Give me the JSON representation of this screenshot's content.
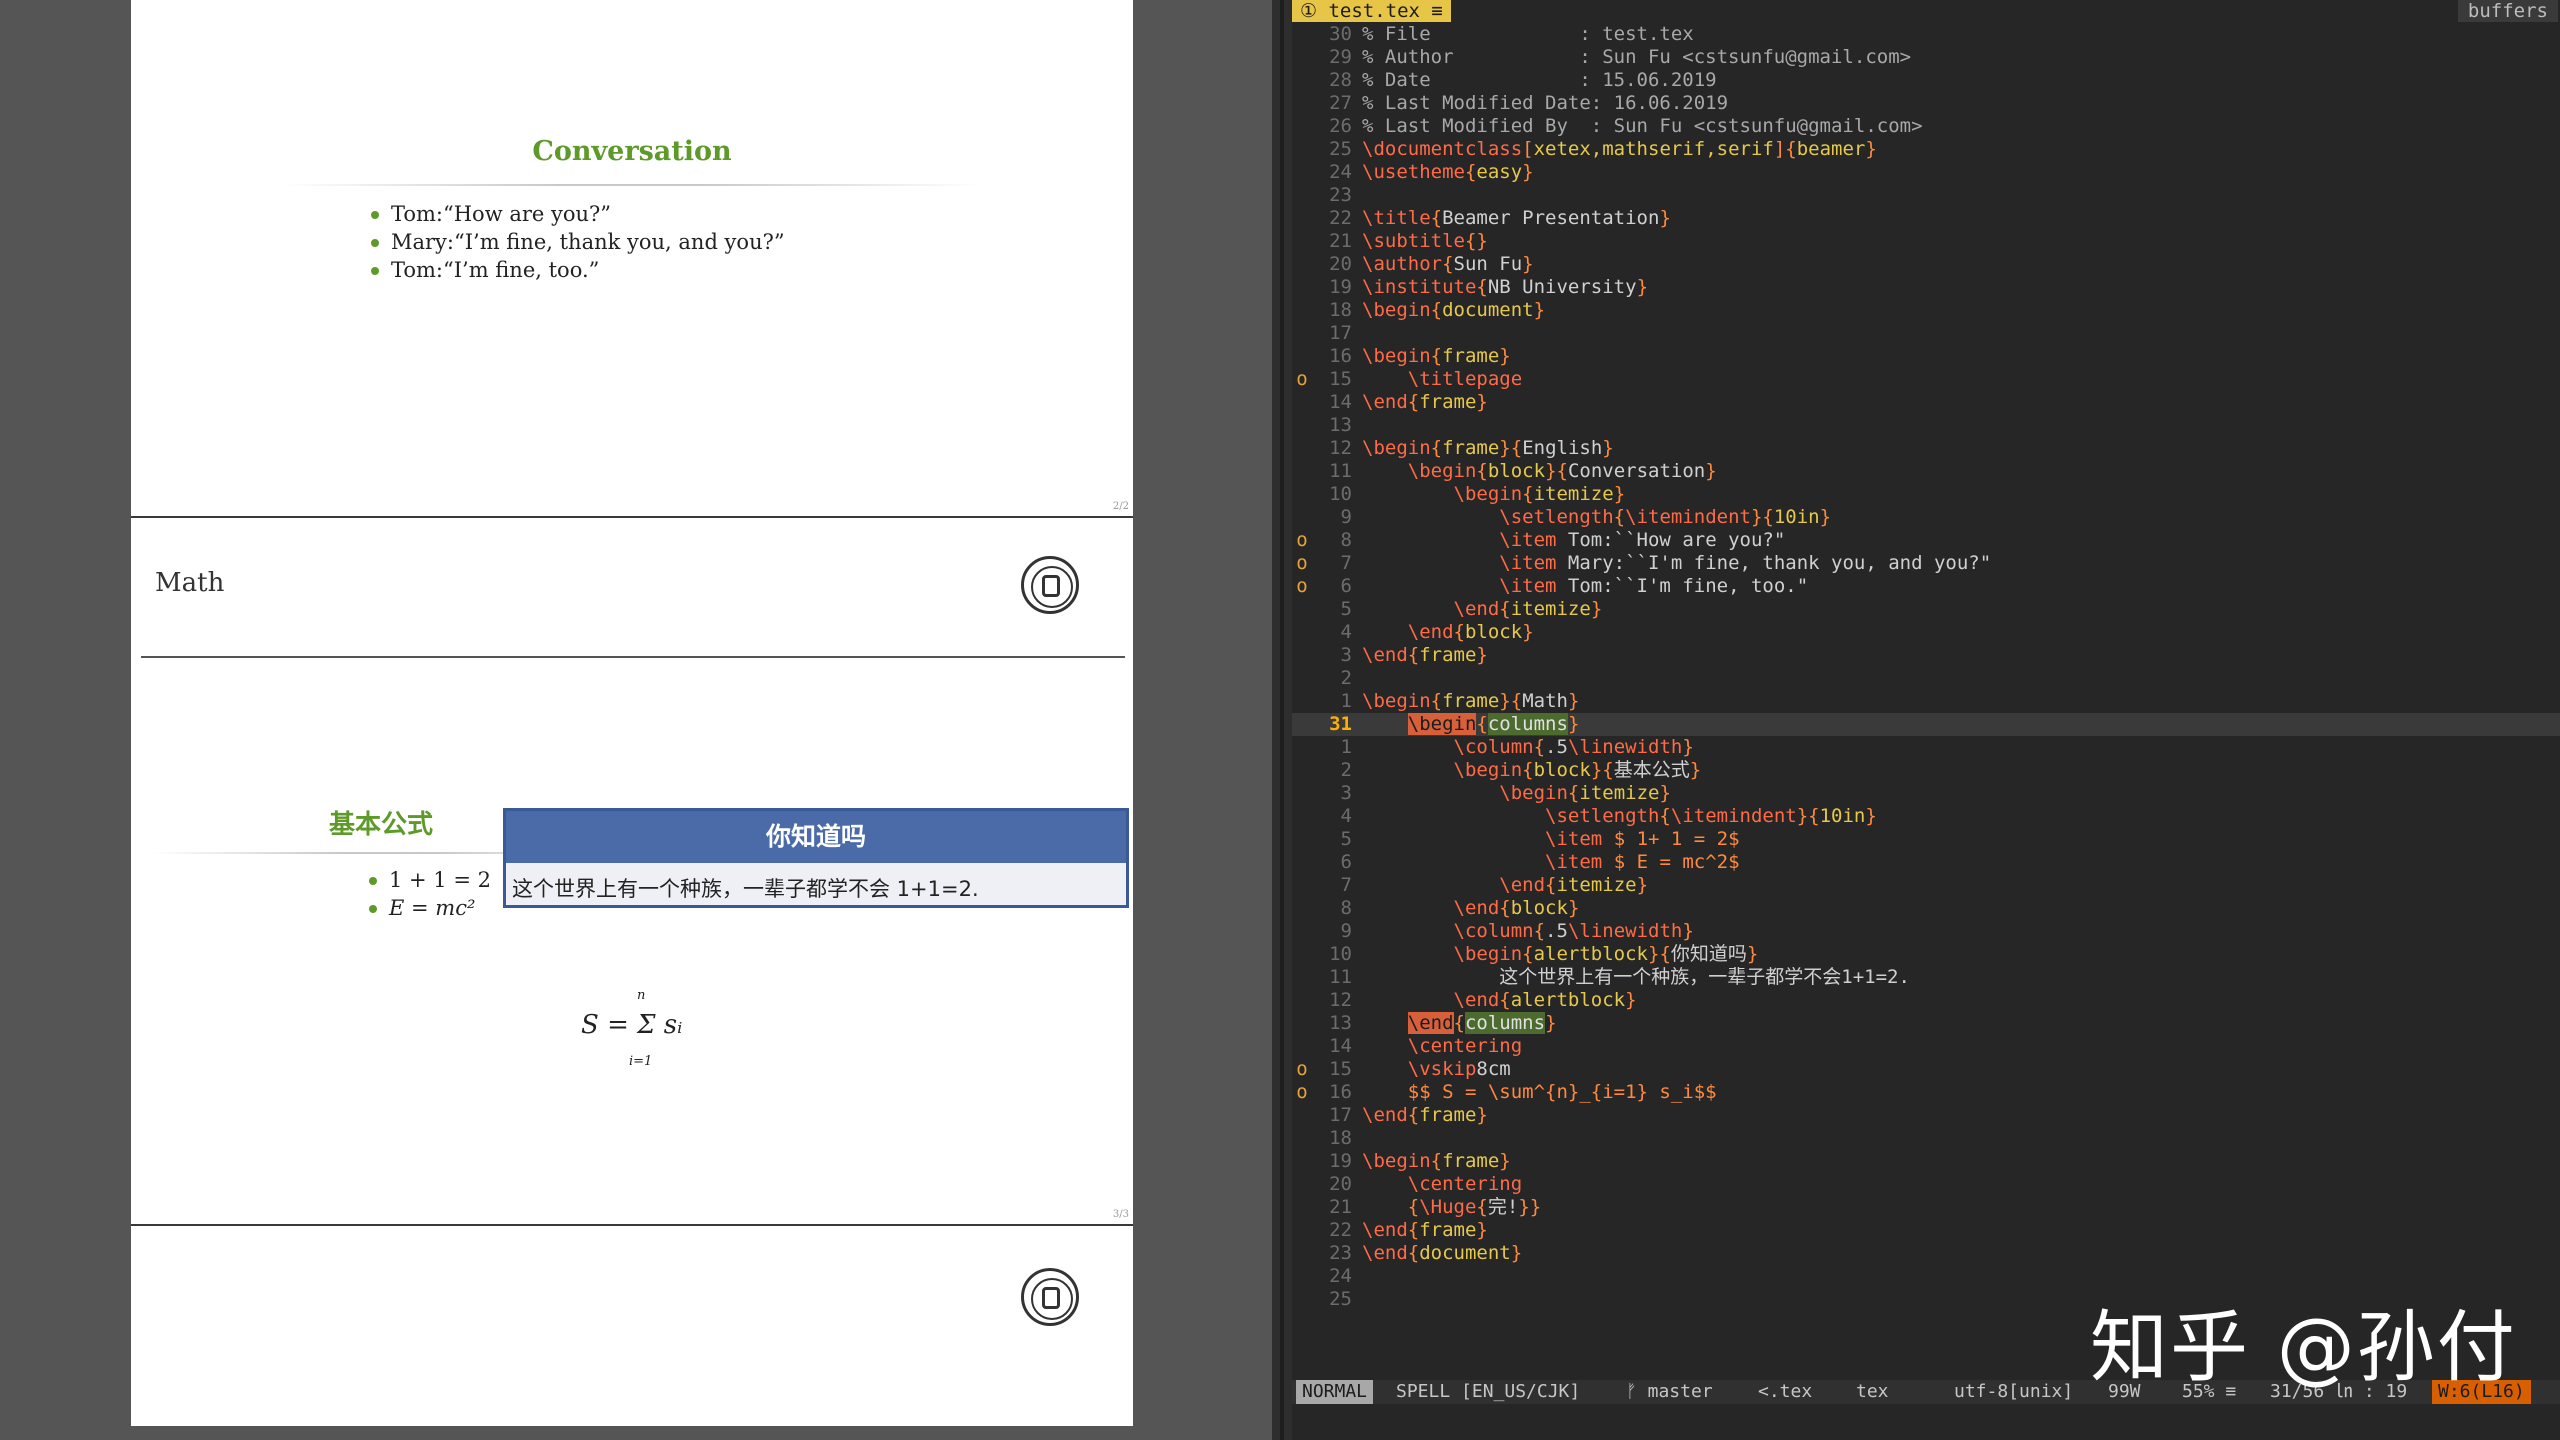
{
  "pdf": {
    "page1": {
      "block_title": "Conversation",
      "items": [
        "Tom:“How are you?”",
        "Mary:“I’m fine, thank you, and you?”",
        "Tom:“I’m fine, too.”"
      ],
      "page_number": "2/2"
    },
    "page2": {
      "frame_title": "Math",
      "block_title": "基本公式",
      "items": [
        "1 + 1 = 2",
        "E = mc²"
      ],
      "alert_title": "你知道吗",
      "alert_body": "这个世界上有一个种族，一辈子都学不会 1+1=2.",
      "formula": "S = Σ sᵢ",
      "formula_upper": "n",
      "formula_lower": "i=1",
      "page_number": "3/3"
    }
  },
  "vim": {
    "tab_active": "① test.tex ≡",
    "tab_right": "buffers",
    "lines": [
      {
        "n": "30",
        "sign": "",
        "cur": false,
        "html": "<span class='c-cm'>% File             : test.tex</span>"
      },
      {
        "n": "29",
        "sign": "",
        "cur": false,
        "html": "<span class='c-cm'>% Author           : Sun Fu &lt;cstsunfu@gmail.com&gt;</span>"
      },
      {
        "n": "28",
        "sign": "",
        "cur": false,
        "html": "<span class='c-cm'>% Date             : 15.06.2019</span>"
      },
      {
        "n": "27",
        "sign": "",
        "cur": false,
        "html": "<span class='c-cm'>% Last Modified Date: 16.06.2019</span>"
      },
      {
        "n": "26",
        "sign": "",
        "cur": false,
        "html": "<span class='c-cm'>% Last Modified By  : Sun Fu &lt;cstsunfu@gmail.com&gt;</span>"
      },
      {
        "n": "25",
        "sign": "",
        "cur": false,
        "html": "<span class='c-kw'>\\documentclass</span><span class='c-op'>[</span><span class='c-ar'>xetex,mathserif,serif</span><span class='c-op'>]{</span><span class='c-ar'>beamer</span><span class='c-op'>}</span>"
      },
      {
        "n": "24",
        "sign": "",
        "cur": false,
        "html": "<span class='c-kw'>\\usetheme</span><span class='c-op'>{</span><span class='c-ar'>easy</span><span class='c-op'>}</span>"
      },
      {
        "n": "23",
        "sign": "",
        "cur": false,
        "html": ""
      },
      {
        "n": "22",
        "sign": "",
        "cur": false,
        "html": "<span class='c-kw'>\\title</span><span class='c-op'>{</span>Beamer Presentation<span class='c-op'>}</span>"
      },
      {
        "n": "21",
        "sign": "",
        "cur": false,
        "html": "<span class='c-kw'>\\subtitle</span><span class='c-op'>{}</span>"
      },
      {
        "n": "20",
        "sign": "",
        "cur": false,
        "html": "<span class='c-kw'>\\author</span><span class='c-op'>{</span>Sun Fu<span class='c-op'>}</span>"
      },
      {
        "n": "19",
        "sign": "",
        "cur": false,
        "html": "<span class='c-kw'>\\institute</span><span class='c-op'>{</span>NB University<span class='c-op'>}</span>"
      },
      {
        "n": "18",
        "sign": "",
        "cur": false,
        "html": "<span class='c-kw'>\\begin</span><span class='c-op'>{</span><span class='c-ar'>document</span><span class='c-op'>}</span>"
      },
      {
        "n": "17",
        "sign": "",
        "cur": false,
        "html": ""
      },
      {
        "n": "16",
        "sign": "",
        "cur": false,
        "html": "<span class='c-kw'>\\begin</span><span class='c-op'>{</span><span class='c-ar'>frame</span><span class='c-op'>}</span>"
      },
      {
        "n": "15",
        "sign": "o",
        "cur": false,
        "html": "    <span class='c-kw'>\\titlepage</span>"
      },
      {
        "n": "14",
        "sign": "",
        "cur": false,
        "html": "<span class='c-kw'>\\end</span><span class='c-op'>{</span><span class='c-ar'>frame</span><span class='c-op'>}</span>"
      },
      {
        "n": "13",
        "sign": "",
        "cur": false,
        "html": ""
      },
      {
        "n": "12",
        "sign": "",
        "cur": false,
        "html": "<span class='c-kw'>\\begin</span><span class='c-op'>{</span><span class='c-ar'>frame</span><span class='c-op'>}{</span>English<span class='c-op'>}</span>"
      },
      {
        "n": "11",
        "sign": "",
        "cur": false,
        "html": "    <span class='c-kw'>\\begin</span><span class='c-op'>{</span><span class='c-ar'>block</span><span class='c-op'>}{</span>Conversation<span class='c-op'>}</span>"
      },
      {
        "n": "10",
        "sign": "",
        "cur": false,
        "html": "        <span class='c-kw'>\\begin</span><span class='c-op'>{</span><span class='c-ar'>itemize</span><span class='c-op'>}</span>"
      },
      {
        "n": "9",
        "sign": "",
        "cur": false,
        "html": "            <span class='c-kw'>\\setlength</span><span class='c-op'>{</span><span class='c-kw'>\\itemindent</span><span class='c-op'>}{</span><span class='c-ar'>10in</span><span class='c-op'>}</span>"
      },
      {
        "n": "8",
        "sign": "o",
        "cur": false,
        "html": "            <span class='c-kw'>\\item</span> Tom:``How are you?\""
      },
      {
        "n": "7",
        "sign": "o",
        "cur": false,
        "html": "            <span class='c-kw'>\\item</span> Mary:``I'm fine, thank you, and you?\""
      },
      {
        "n": "6",
        "sign": "o",
        "cur": false,
        "html": "            <span class='c-kw'>\\item</span> Tom:``I'm fine, too.\""
      },
      {
        "n": "5",
        "sign": "",
        "cur": false,
        "html": "        <span class='c-kw'>\\end</span><span class='c-op'>{</span><span class='c-ar'>itemize</span><span class='c-op'>}</span>"
      },
      {
        "n": "4",
        "sign": "",
        "cur": false,
        "html": "    <span class='c-kw'>\\end</span><span class='c-op'>{</span><span class='c-ar'>block</span><span class='c-op'>}</span>"
      },
      {
        "n": "3",
        "sign": "",
        "cur": false,
        "html": "<span class='c-kw'>\\end</span><span class='c-op'>{</span><span class='c-ar'>frame</span><span class='c-op'>}</span>"
      },
      {
        "n": "2",
        "sign": "",
        "cur": false,
        "html": ""
      },
      {
        "n": "1",
        "sign": "",
        "cur": false,
        "html": "<span class='c-kw'>\\begin</span><span class='c-op'>{</span><span class='c-ar'>frame</span><span class='c-op'>}{</span>Math<span class='c-op'>}</span>"
      },
      {
        "n": "31",
        "sign": "",
        "cur": true,
        "html": "    <span class='hl'>\\begin</span><span class='c-op'>{</span><span class='hl2'>columns</span><span class='c-op'>}</span>"
      },
      {
        "n": "1",
        "sign": "",
        "cur": false,
        "html": "        <span class='c-kw'>\\column</span><span class='c-op'>{</span>.5<span class='c-kw'>\\linewidth</span><span class='c-op'>}</span>"
      },
      {
        "n": "2",
        "sign": "",
        "cur": false,
        "html": "        <span class='c-kw'>\\begin</span><span class='c-op'>{</span><span class='c-ar'>block</span><span class='c-op'>}{</span>基本公式<span class='c-op'>}</span>"
      },
      {
        "n": "3",
        "sign": "",
        "cur": false,
        "html": "            <span class='c-kw'>\\begin</span><span class='c-op'>{</span><span class='c-ar'>itemize</span><span class='c-op'>}</span>"
      },
      {
        "n": "4",
        "sign": "",
        "cur": false,
        "html": "                <span class='c-kw'>\\setlength</span><span class='c-op'>{</span><span class='c-kw'>\\itemindent</span><span class='c-op'>}{</span><span class='c-ar'>10in</span><span class='c-op'>}</span>"
      },
      {
        "n": "5",
        "sign": "",
        "cur": false,
        "html": "                <span class='c-kw'>\\item</span> <span class='c-op'>$ 1+ 1 = 2$</span>"
      },
      {
        "n": "6",
        "sign": "",
        "cur": false,
        "html": "                <span class='c-kw'>\\item</span> <span class='c-op'>$ E = mc^2$</span>"
      },
      {
        "n": "7",
        "sign": "",
        "cur": false,
        "html": "            <span class='c-kw'>\\end</span><span class='c-op'>{</span><span class='c-ar'>itemize</span><span class='c-op'>}</span>"
      },
      {
        "n": "8",
        "sign": "",
        "cur": false,
        "html": "        <span class='c-kw'>\\end</span><span class='c-op'>{</span><span class='c-ar'>block</span><span class='c-op'>}</span>"
      },
      {
        "n": "9",
        "sign": "",
        "cur": false,
        "html": "        <span class='c-kw'>\\column</span><span class='c-op'>{</span>.5<span class='c-kw'>\\linewidth</span><span class='c-op'>}</span>"
      },
      {
        "n": "10",
        "sign": "",
        "cur": false,
        "html": "        <span class='c-kw'>\\begin</span><span class='c-op'>{</span><span class='c-ar'>alertblock</span><span class='c-op'>}{</span>你知道吗<span class='c-op'>}</span>"
      },
      {
        "n": "11",
        "sign": "",
        "cur": false,
        "html": "            这个世界上有一个种族，一辈子都学不会1+1=2."
      },
      {
        "n": "12",
        "sign": "",
        "cur": false,
        "html": "        <span class='c-kw'>\\end</span><span class='c-op'>{</span><span class='c-ar'>alertblock</span><span class='c-op'>}</span>"
      },
      {
        "n": "13",
        "sign": "",
        "cur": false,
        "html": "    <span class='hl'>\\end</span><span class='c-op'>{</span><span class='hl2'>columns</span><span class='c-op'>}</span>"
      },
      {
        "n": "14",
        "sign": "",
        "cur": false,
        "html": "    <span class='c-kw'>\\centering</span>"
      },
      {
        "n": "15",
        "sign": "o",
        "cur": false,
        "html": "    <span class='c-kw'>\\vskip</span>8cm"
      },
      {
        "n": "16",
        "sign": "o",
        "cur": false,
        "html": "    <span class='c-op'>$$ S = \\sum^{n}_{i=1} s_i$$</span>"
      },
      {
        "n": "17",
        "sign": "",
        "cur": false,
        "html": "<span class='c-kw'>\\end</span><span class='c-op'>{</span><span class='c-ar'>frame</span><span class='c-op'>}</span>"
      },
      {
        "n": "18",
        "sign": "",
        "cur": false,
        "html": ""
      },
      {
        "n": "19",
        "sign": "",
        "cur": false,
        "html": "<span class='c-kw'>\\begin</span><span class='c-op'>{</span><span class='c-ar'>frame</span><span class='c-op'>}</span>"
      },
      {
        "n": "20",
        "sign": "",
        "cur": false,
        "html": "    <span class='c-kw'>\\centering</span>"
      },
      {
        "n": "21",
        "sign": "",
        "cur": false,
        "html": "    <span class='c-op'>{</span><span class='c-kw'>\\Huge</span><span class='c-op'>{</span>完!<span class='c-op'>}}</span>"
      },
      {
        "n": "22",
        "sign": "",
        "cur": false,
        "html": "<span class='c-kw'>\\end</span><span class='c-op'>{</span><span class='c-ar'>frame</span><span class='c-op'>}</span>"
      },
      {
        "n": "23",
        "sign": "",
        "cur": false,
        "html": "<span class='c-kw'>\\end</span><span class='c-op'>{</span><span class='c-ar'>document</span><span class='c-op'>}</span>"
      },
      {
        "n": "24",
        "sign": "",
        "cur": false,
        "html": ""
      },
      {
        "n": "25",
        "sign": "",
        "cur": false,
        "html": ""
      }
    ],
    "status": {
      "mode": "NORMAL",
      "spell": "SPELL [EN_US/CJK]",
      "branch": "ᚠ master",
      "ext": "<.tex",
      "filetype": "tex",
      "encoding": "utf-8[unix]",
      "words": "99W",
      "percent": "55% ≡",
      "position": "31/56 ㏑ : 19",
      "warning": "W:6(L16)"
    }
  },
  "watermark": "知乎 @孙付",
  "colors": {
    "beamer_green": "#5e9a2a",
    "alert_blue": "#4a6ba8",
    "vim_bg": "#262626",
    "tab_yellow": "#e7c547"
  }
}
